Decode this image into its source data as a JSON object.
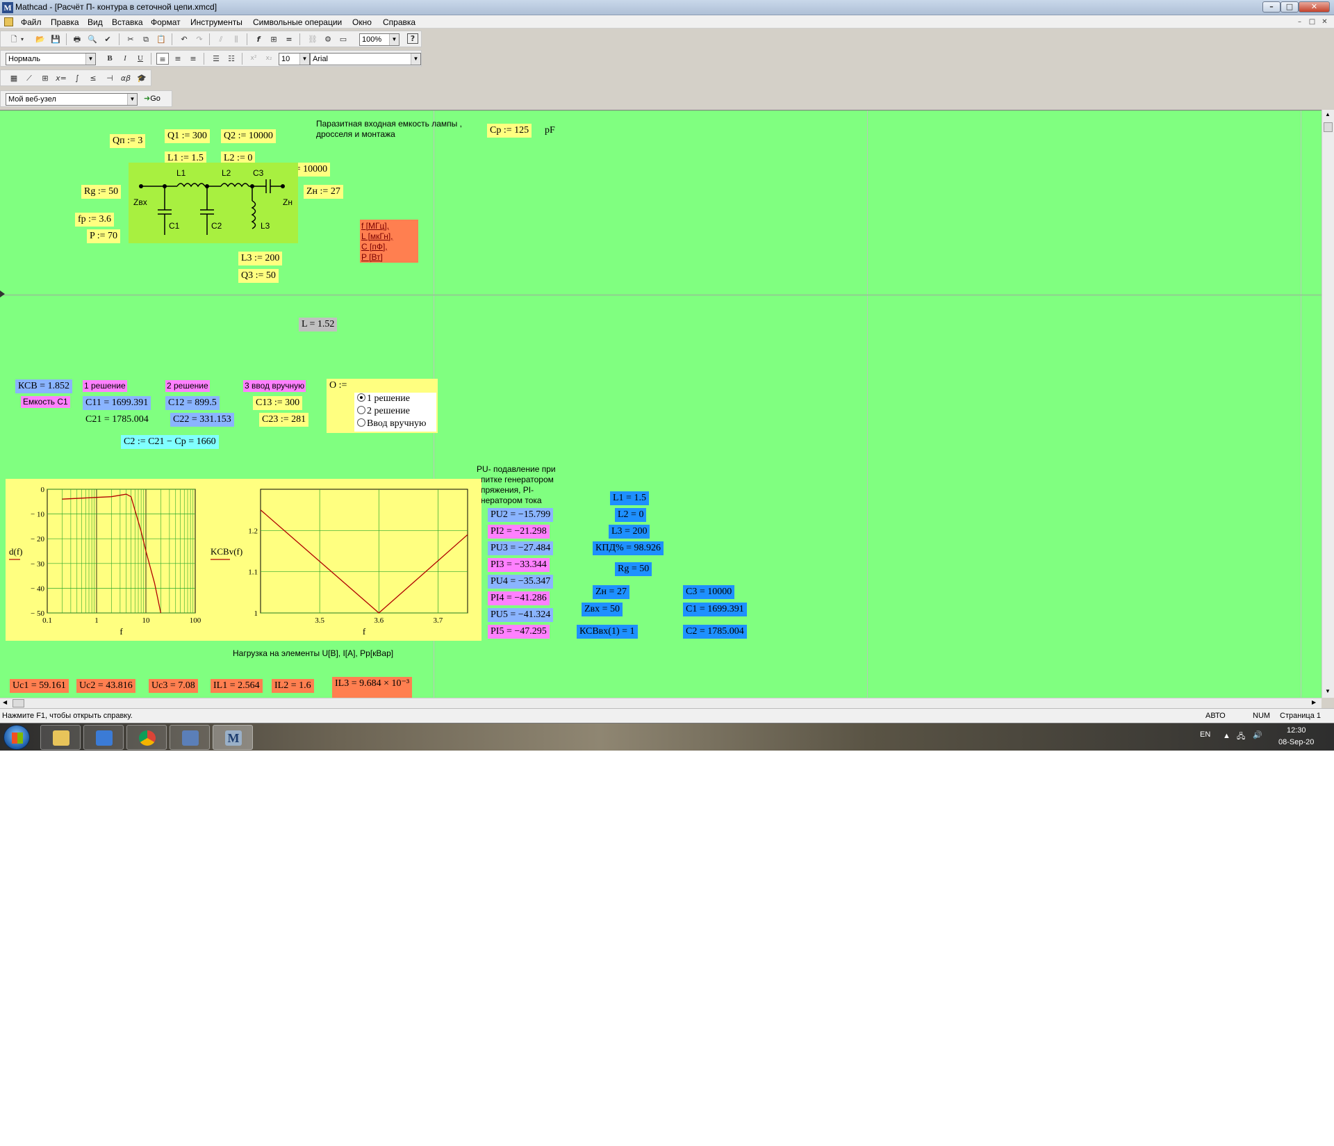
{
  "window": {
    "title": "Mathcad - [Расчёт П- контура в сеточной цепи.xmcd]",
    "app_icon": "M",
    "controls": {
      "minimize": "–",
      "maximize": "□",
      "close": "✕"
    }
  },
  "menu": [
    "Файл",
    "Правка",
    "Вид",
    "Вставка",
    "Формат",
    "Инструменты",
    "Символьные операции",
    "Окно",
    "Справка"
  ],
  "toolbar": {
    "zoom": "100%",
    "style": "Нормаль",
    "font_size": "10",
    "font": "Arial",
    "web": "Мой веб-узел",
    "go": "Go",
    "bold": "B",
    "italic": "I",
    "underline": "U",
    "superscript": "x²",
    "subscript": "x₂",
    "help": "?"
  },
  "worksheet": {
    "inputs": {
      "qn": "Qп := 3",
      "q1": "Q1 := 300",
      "q2": "Q2 := 10000",
      "l1": "L1 := 1.5",
      "l2": "L2 := 0",
      "c3": "C3 := 10000",
      "rg": "Rg := 50",
      "zn": "Zн := 27",
      "fp": "fр := 3.6",
      "p": "P := 70",
      "l3": "L3 := 200",
      "q3": "Q3 := 50",
      "cp": "Cp := 125",
      "cp_unit": "pF"
    },
    "parasitic_note": [
      "Паразитная входная емкость лампы ,",
      "дросселя и монтажа"
    ],
    "units_note": [
      "f [МГц],",
      "L [мкГн],",
      "C [пФ],",
      "P [Вт]"
    ],
    "schematic": {
      "l1": "L1",
      "l2": "L2",
      "c3": "C3",
      "zvx": "Zвх",
      "zn": "Zн",
      "c1": "C1",
      "c2": "C2",
      "l3": "L3"
    },
    "l_result": "L = 1.52",
    "ksv": "КСВ = 1.852",
    "cap_c1": "Емкость С1",
    "sol1": "1 решение",
    "sol2": "2 решение",
    "sol3": "3 ввод вручную",
    "c11": "C11 = 1699.391",
    "c12": "C12 = 899.5",
    "c13": "C13 := 300",
    "c21": "C21 = 1785.004",
    "c22": "C22 = 331.153",
    "c23": "C23 := 281",
    "c2": "C2 := C21 − Cp = 1660",
    "o_label": "O :=",
    "options": [
      "1 решение",
      "2 решение",
      "Ввод вручную"
    ],
    "selected_option": "1 решение",
    "pu_note": [
      "PU- подавление при",
      "питке генератором",
      "пряжения, PI-",
      "нератором тока"
    ],
    "pu_values": [
      "PU2 = −15.799",
      "PI2 = −21.298",
      "PU3 = −27.484",
      "PI3 = −33.344",
      "PU4 = −35.347",
      "PI4 = −41.286",
      "PU5 = −41.324",
      "PI5 = −47.295"
    ],
    "summary": {
      "l1": "L1 = 1.5",
      "l2": "L2 = 0",
      "l3": "L3 = 200",
      "kpd": "КПД% = 98.926",
      "rg": "Rg = 50",
      "zn": "Zн = 27",
      "zvx": "Zвх = 50",
      "ksv_in": "КСВвх(1) = 1",
      "c3": "C3 = 10000",
      "c1": "C1 = 1699.391",
      "c2": "C2 = 1785.004"
    },
    "load_title": "Нагрузка на элементы U[В], I[А], Pр[кВар]",
    "loads": [
      "Uc1 = 59.161",
      "Uc2 = 43.816",
      "Uc3 = 7.08",
      "IL1 = 2.564",
      "IL2 = 1.6",
      "IL3 = 9.684 × 10⁻³"
    ]
  },
  "chart_data": [
    {
      "type": "line",
      "ylabel": "d(f)",
      "xlabel": "f",
      "xscale": "log",
      "x_ticks": [
        "0.1",
        "1",
        "10",
        "100"
      ],
      "y_ticks": [
        "0",
        "− 10",
        "− 20",
        "− 30",
        "− 40",
        "− 50"
      ],
      "xlim": [
        0.1,
        100
      ],
      "ylim": [
        -50,
        0
      ],
      "series": [
        {
          "x": [
            0.2,
            0.5,
            1,
            2,
            4,
            5,
            8,
            10,
            15,
            20
          ],
          "y": [
            -4,
            -3.6,
            -3.3,
            -3,
            -2,
            -3,
            -17,
            -25,
            -38,
            -50
          ]
        }
      ]
    },
    {
      "type": "line",
      "ylabel": "KCBv(f)",
      "xlabel": "f",
      "x_ticks": [
        "3.5",
        "3.6",
        "3.7"
      ],
      "y_ticks": [
        "1.2",
        "1.1",
        "1"
      ],
      "xlim": [
        3.4,
        3.75
      ],
      "ylim": [
        1,
        1.3
      ],
      "series": [
        {
          "x": [
            3.4,
            3.6,
            3.75
          ],
          "y": [
            1.25,
            1.0,
            1.19
          ]
        }
      ]
    }
  ],
  "status": {
    "hint": "Нажмите F1, чтобы открыть справку.",
    "mode": "АВТО",
    "num": "NUM",
    "page": "Страница 1"
  },
  "taskbar": {
    "lang": "EN",
    "time": "12:30",
    "date": "08-Sep-20"
  }
}
